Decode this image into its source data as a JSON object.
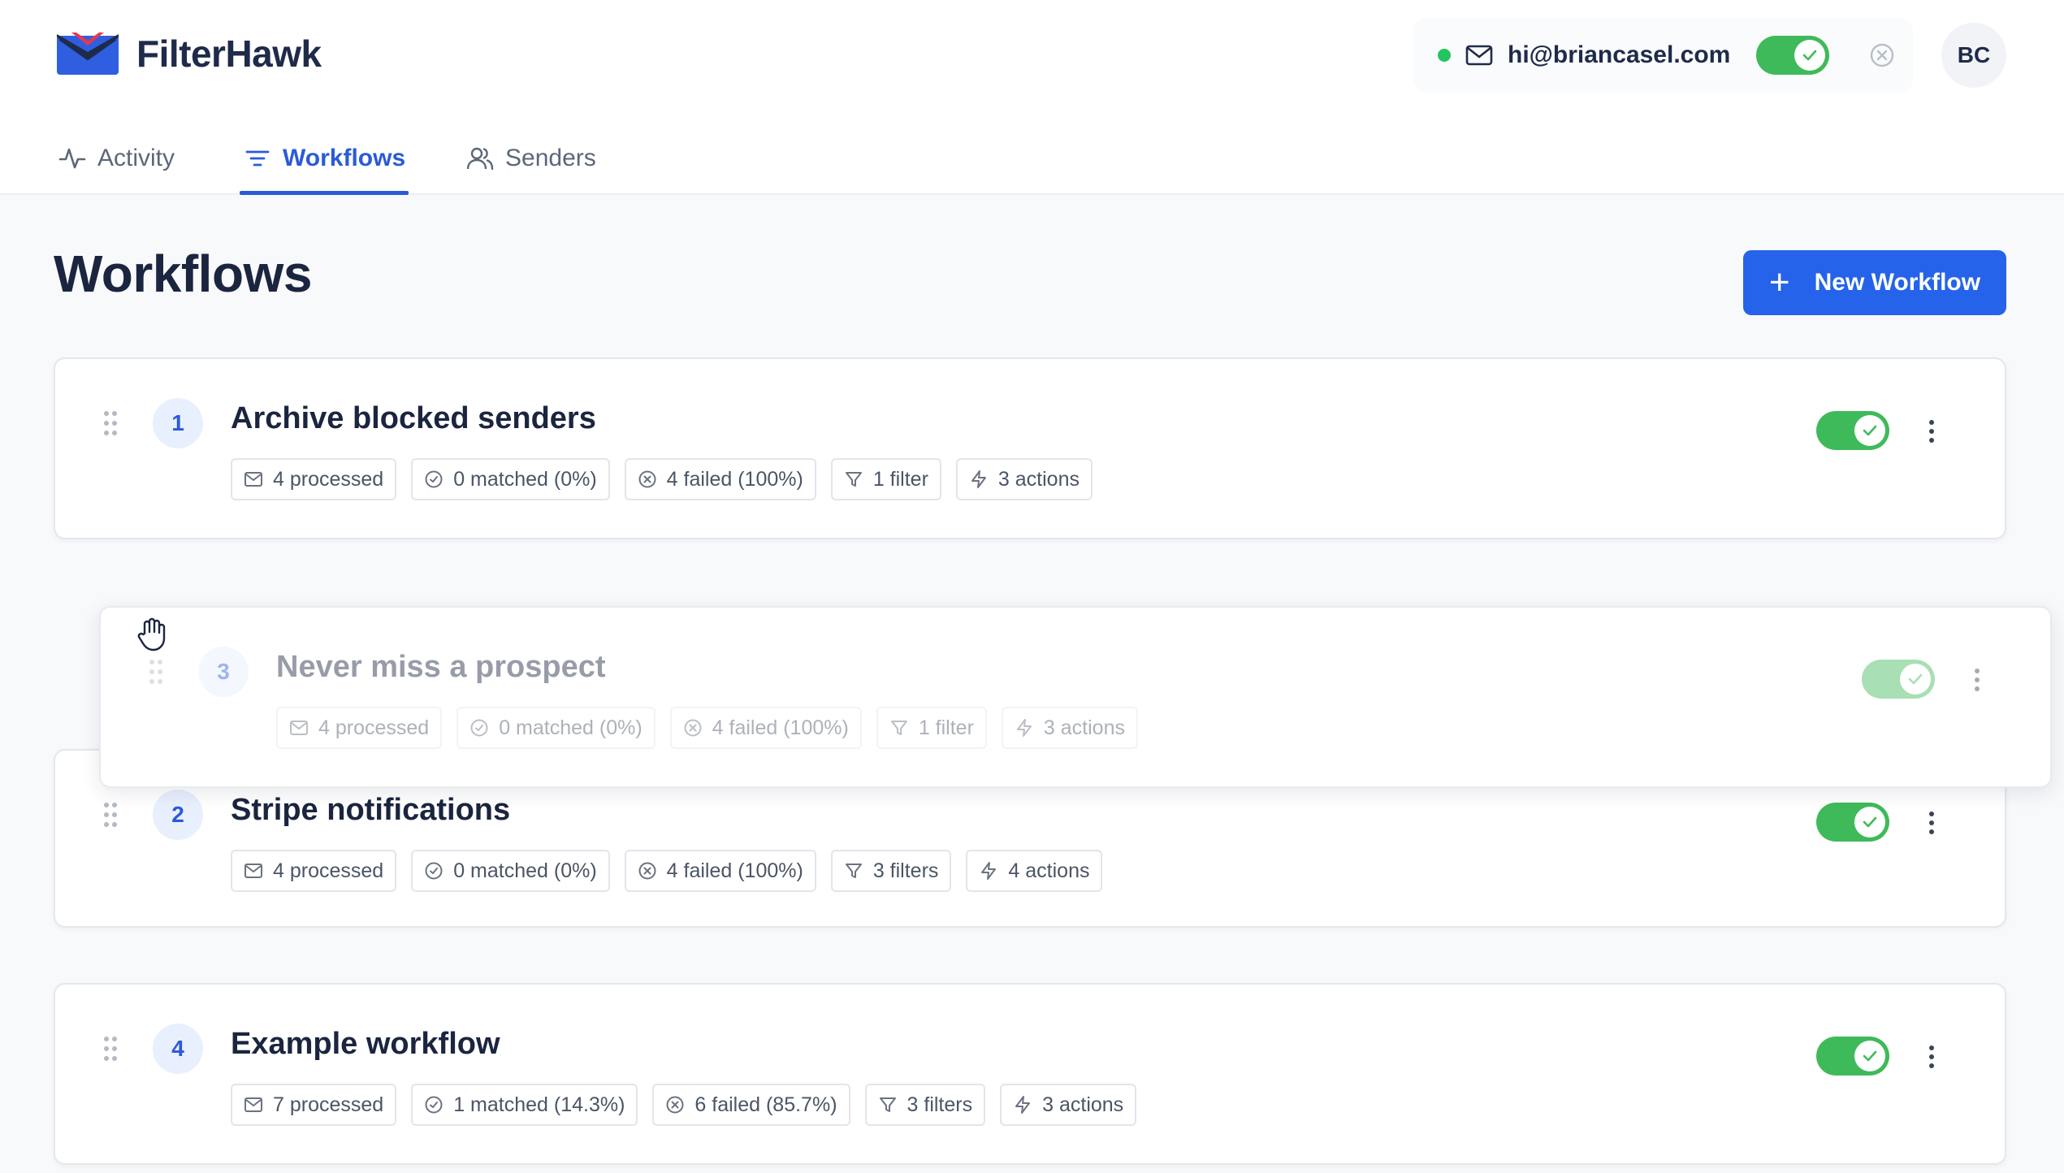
{
  "app": {
    "name": "FilterHawk"
  },
  "account": {
    "email": "hi@briancasel.com",
    "connected": true,
    "enabled": true,
    "avatar_initials": "BC"
  },
  "nav": {
    "tabs": [
      {
        "label": "Activity",
        "icon": "activity-icon",
        "active": false
      },
      {
        "label": "Workflows",
        "icon": "filter-lines-icon",
        "active": true
      },
      {
        "label": "Senders",
        "icon": "users-icon",
        "active": false
      }
    ]
  },
  "page": {
    "title": "Workflows",
    "new_button_label": "New Workflow"
  },
  "colors": {
    "accent": "#2563eb",
    "toggle_on": "#3fba5a",
    "status_online": "#22c55e",
    "badge_bg": "#e8effd"
  },
  "workflows": [
    {
      "number": "1",
      "title": "Archive blocked senders",
      "enabled": true,
      "processed": "4 processed",
      "matched": "0 matched (0%)",
      "failed": "4 failed (100%)",
      "filters": "1 filter",
      "actions": "3 actions"
    },
    {
      "number": "3",
      "title": "Never miss a prospect",
      "enabled": true,
      "dragging": true,
      "processed": "4 processed",
      "matched": "0 matched (0%)",
      "failed": "4 failed (100%)",
      "filters": "1 filter",
      "actions": "3 actions"
    },
    {
      "number": "2",
      "title": "Stripe notifications",
      "enabled": true,
      "processed": "4 processed",
      "matched": "0 matched (0%)",
      "failed": "4 failed (100%)",
      "filters": "3 filters",
      "actions": "4 actions"
    },
    {
      "number": "4",
      "title": "Example workflow",
      "enabled": true,
      "processed": "7 processed",
      "matched": "1 matched (14.3%)",
      "failed": "6 failed (85.7%)",
      "filters": "3 filters",
      "actions": "3 actions"
    }
  ]
}
